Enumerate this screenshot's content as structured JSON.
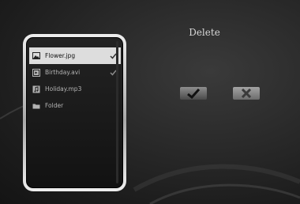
{
  "dialog": {
    "title": "Delete",
    "confirm_icon": "check-icon",
    "cancel_icon": "x-icon"
  },
  "file_list": {
    "items": [
      {
        "label": "Flower.jpg",
        "icon": "image-icon",
        "selected": true,
        "checked": true
      },
      {
        "label": "Birthday.avi",
        "icon": "video-icon",
        "selected": false,
        "checked": true
      },
      {
        "label": "Holiday.mp3",
        "icon": "music-icon",
        "selected": false,
        "checked": false
      },
      {
        "label": "Folder",
        "icon": "folder-icon",
        "selected": false,
        "checked": false
      }
    ]
  },
  "colors": {
    "background": "#1c1c1c",
    "panel_border": "#d6d6d6",
    "selection": "#dddddd",
    "text": "#b3b3b3"
  }
}
